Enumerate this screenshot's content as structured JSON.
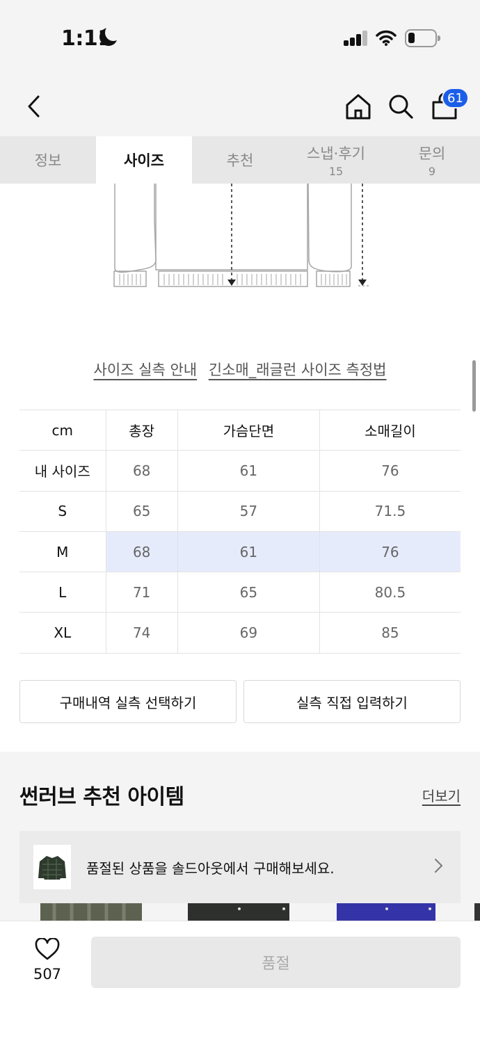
{
  "status": {
    "time": "1:11"
  },
  "header": {
    "cart_count": "61"
  },
  "tabs": [
    {
      "label": "정보",
      "sub": ""
    },
    {
      "label": "사이즈",
      "sub": ""
    },
    {
      "label": "추천",
      "sub": ""
    },
    {
      "label": "스냅·후기",
      "sub": "15"
    },
    {
      "label": "문의",
      "sub": "9"
    }
  ],
  "links": {
    "guide": "사이즈 실측 안내",
    "method": "긴소매_래글런 사이즈 측정법"
  },
  "size_table": {
    "headers": [
      "cm",
      "총장",
      "가슴단면",
      "소매길이"
    ],
    "rows": [
      {
        "label": "내 사이즈",
        "values": [
          "68",
          "61",
          "76"
        ]
      },
      {
        "label": "S",
        "values": [
          "65",
          "57",
          "71.5"
        ]
      },
      {
        "label": "M",
        "values": [
          "68",
          "61",
          "76"
        ]
      },
      {
        "label": "L",
        "values": [
          "71",
          "65",
          "80.5"
        ]
      },
      {
        "label": "XL",
        "values": [
          "74",
          "69",
          "85"
        ]
      }
    ]
  },
  "actions": {
    "history": "구매내역 실측 선택하기",
    "manual": "실측 직접 입력하기"
  },
  "recommend": {
    "title": "썬러브 추천 아이템",
    "more": "더보기",
    "soldout_msg": "품절된 상품을 솔드아웃에서 구매해보세요."
  },
  "bottom": {
    "likes": "507",
    "buy_label": "품절"
  },
  "colors": {
    "accent": "#1b5ee8",
    "highlight_row": "#e6ebfc"
  }
}
